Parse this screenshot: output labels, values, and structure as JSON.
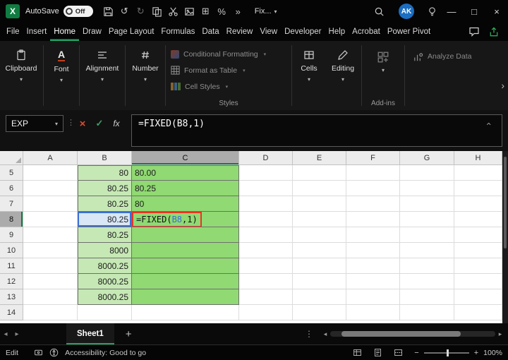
{
  "titlebar": {
    "autosave_label": "AutoSave",
    "autosave_state": "Off",
    "style_dropdown": "Fix...",
    "avatar_initials": "AK"
  },
  "menubar": {
    "items": [
      "File",
      "Insert",
      "Home",
      "Draw",
      "Page Layout",
      "Formulas",
      "Data",
      "Review",
      "View",
      "Developer",
      "Help",
      "Acrobat",
      "Power Pivot"
    ],
    "active_item": "Home"
  },
  "ribbon": {
    "big_buttons": [
      "Clipboard",
      "Font",
      "Alignment",
      "Number"
    ],
    "styles_buttons": [
      "Conditional Formatting",
      "Format as Table",
      "Cell Styles"
    ],
    "styles_group_label": "Styles",
    "cells_label": "Cells",
    "editing_label": "Editing",
    "addins_label": "Add-ins",
    "analyze_data_label": "Analyze Data"
  },
  "formula_bar": {
    "name_box_value": "EXP",
    "cancel_label": "×",
    "enter_label": "✓",
    "fx_label": "fx",
    "formula": "=FIXED(B8,1)"
  },
  "grid": {
    "column_headers": [
      "A",
      "B",
      "C",
      "D",
      "E",
      "F",
      "G",
      "H"
    ],
    "active_column": "C",
    "active_row": 8,
    "cell_formula": {
      "prefix": "=FIXED(",
      "ref": "B8",
      "suffix": ",1)"
    },
    "rows": [
      {
        "n": "5",
        "b": "80",
        "c": "80.00",
        "green": true
      },
      {
        "n": "6",
        "b": "80.25",
        "c": "80.25",
        "green": true
      },
      {
        "n": "7",
        "b": "80.25",
        "c": "80",
        "green": true
      },
      {
        "n": "8",
        "b": "80.25",
        "c": "",
        "green": true
      },
      {
        "n": "9",
        "b": "80.25",
        "c": "",
        "green": true
      },
      {
        "n": "10",
        "b": "8000",
        "c": "",
        "green": true
      },
      {
        "n": "11",
        "b": "8000.25",
        "c": "",
        "green": true
      },
      {
        "n": "12",
        "b": "8000.25",
        "c": "",
        "green": true
      },
      {
        "n": "13",
        "b": "8000.25",
        "c": "",
        "green": true
      },
      {
        "n": "14",
        "b": "",
        "c": "",
        "green": false
      }
    ]
  },
  "sheet_bar": {
    "tabs": [
      {
        "label": "Sheet1",
        "active": true
      }
    ],
    "add_button": "+"
  },
  "status_bar": {
    "mode": "Edit",
    "accessibility_text": "Accessibility: Good to go",
    "zoom_level": "100%"
  },
  "icons": {
    "undo": "↺",
    "redo": "↻",
    "borders": "⊞",
    "percent": "%",
    "more": "»",
    "dropdown": "▾",
    "ribbon_more": "›",
    "collapse_formula_bar": "^",
    "dots": "⋮",
    "nav_left": "◂",
    "nav_right": "▸",
    "minimize": "—",
    "maximize": "□",
    "close": "×",
    "zoom_out": "−",
    "zoom_in": "+"
  },
  "colors": {
    "excel_green": "#21a366",
    "b_column_fill": "#c6e8b5",
    "c_column_fill": "#90d973",
    "referenced_cell_blue": "#3b6fd4",
    "edit_border_red": "#eb3323",
    "avatar_blue": "#1b6ec2"
  }
}
